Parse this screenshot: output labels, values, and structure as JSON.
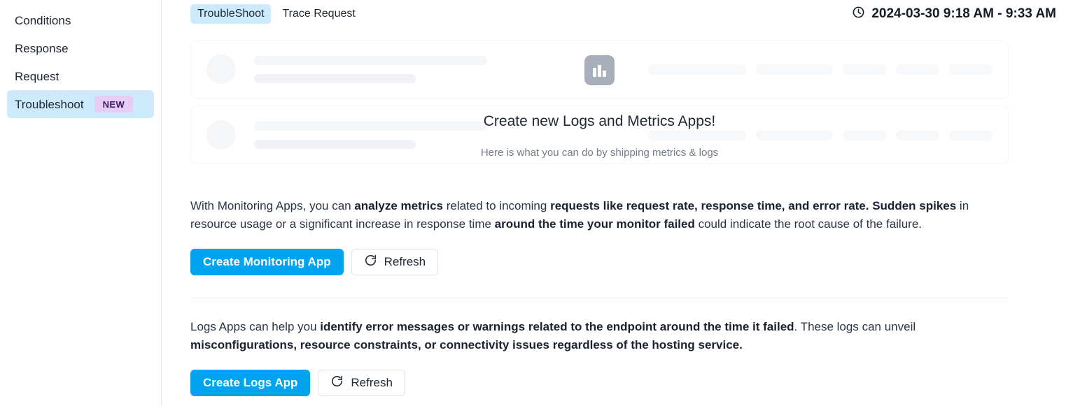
{
  "sidebar": {
    "items": [
      {
        "label": "Conditions",
        "active": false,
        "badge": null
      },
      {
        "label": "Response",
        "active": false,
        "badge": null
      },
      {
        "label": "Request",
        "active": false,
        "badge": null
      },
      {
        "label": "Troubleshoot",
        "active": true,
        "badge": "NEW"
      }
    ]
  },
  "topbar": {
    "tabs": [
      {
        "label": "TroubleShoot",
        "active": true
      },
      {
        "label": "Trace Request",
        "active": false
      }
    ],
    "time_range": "2024-03-30 9:18 AM - 9:33 AM",
    "clock_icon": "clock-icon"
  },
  "empty_state": {
    "icon": "bar-chart-icon",
    "title": "Create new Logs and Metrics Apps!",
    "subtitle": "Here is what you can do by shipping metrics & logs"
  },
  "metrics_section": {
    "paragraph": {
      "t1": "With Monitoring Apps, you can ",
      "b1": "analyze metrics",
      "t2": " related to incoming ",
      "b2": "requests like request rate, response time, and error rate. Sudden spikes",
      "t3": " in resource usage or a significant increase in response time ",
      "b3": "around the time your monitor failed",
      "t4": " could indicate the root cause of the failure."
    },
    "create_button": "Create Monitoring App",
    "refresh_button": "Refresh",
    "refresh_icon": "refresh-icon"
  },
  "logs_section": {
    "paragraph": {
      "t1": "Logs Apps can help you ",
      "b1": "identify error messages or warnings related to the endpoint around the time it failed",
      "t2": ". These logs can unveil ",
      "b2": "misconfigurations, resource constraints, or connectivity issues regardless of the hosting service.",
      "t3": ""
    },
    "create_button": "Create Logs App",
    "refresh_button": "Refresh",
    "refresh_icon": "refresh-icon"
  },
  "colors": {
    "accent": "#00a3f0",
    "active_nav_bg": "#cdeafc",
    "badge_bg": "#e7ccf5",
    "badge_text": "#3b1a63",
    "skeleton": "#f5f6f8",
    "chart_badge": "#a9afba"
  }
}
